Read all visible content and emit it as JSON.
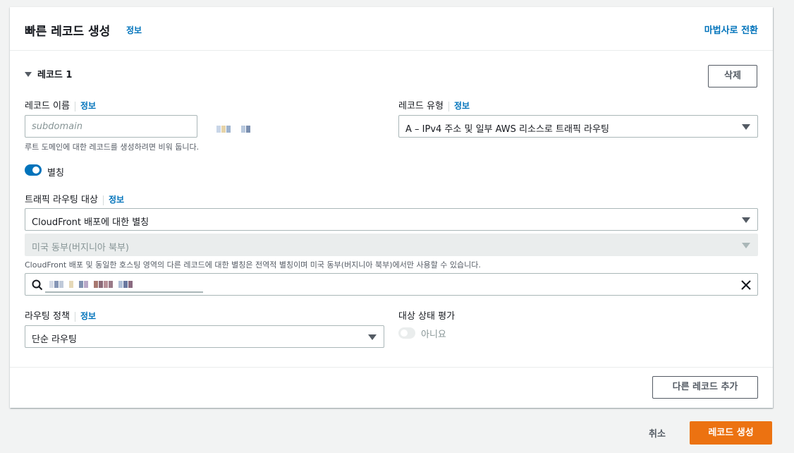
{
  "header": {
    "title": "빠른 레코드 생성",
    "info": "정보",
    "wizard_link": "마법사로 전환"
  },
  "record": {
    "section_title": "레코드 1",
    "delete_label": "삭제",
    "name": {
      "label": "레코드 이름",
      "info": "정보",
      "placeholder": "subdomain",
      "hint": "루트 도메인에 대한 레코드를 생성하려면 비워 둡니다."
    },
    "type": {
      "label": "레코드 유형",
      "info": "정보",
      "value": "A – IPv4 주소 및 일부 AWS 리소스로 트래픽 라우팅"
    },
    "alias": {
      "label": "별칭",
      "on": true
    },
    "target": {
      "label": "트래픽 라우팅 대상",
      "info": "정보",
      "endpoint": "CloudFront 배포에 대한 별칭",
      "region": "미국 동부(버지니아 북부)",
      "region_hint": "CloudFront 배포 및 동일한 호스팅 영역의 다른 레코드에 대한 별칭은 전역적 별칭이며 미국 동부(버지니아 북부)에서만 사용할 수 있습니다."
    },
    "routing": {
      "label": "라우팅 정책",
      "info": "정보",
      "value": "단순 라우팅"
    },
    "health": {
      "label": "대상 상태 평가",
      "value": "아니요",
      "on": false
    }
  },
  "add_record_label": "다른 레코드 추가",
  "footer": {
    "cancel": "취소",
    "create": "레코드 생성"
  },
  "colors": {
    "accent": "#ec7211",
    "link": "#0073bb",
    "toggle_on": "#0073bb"
  }
}
